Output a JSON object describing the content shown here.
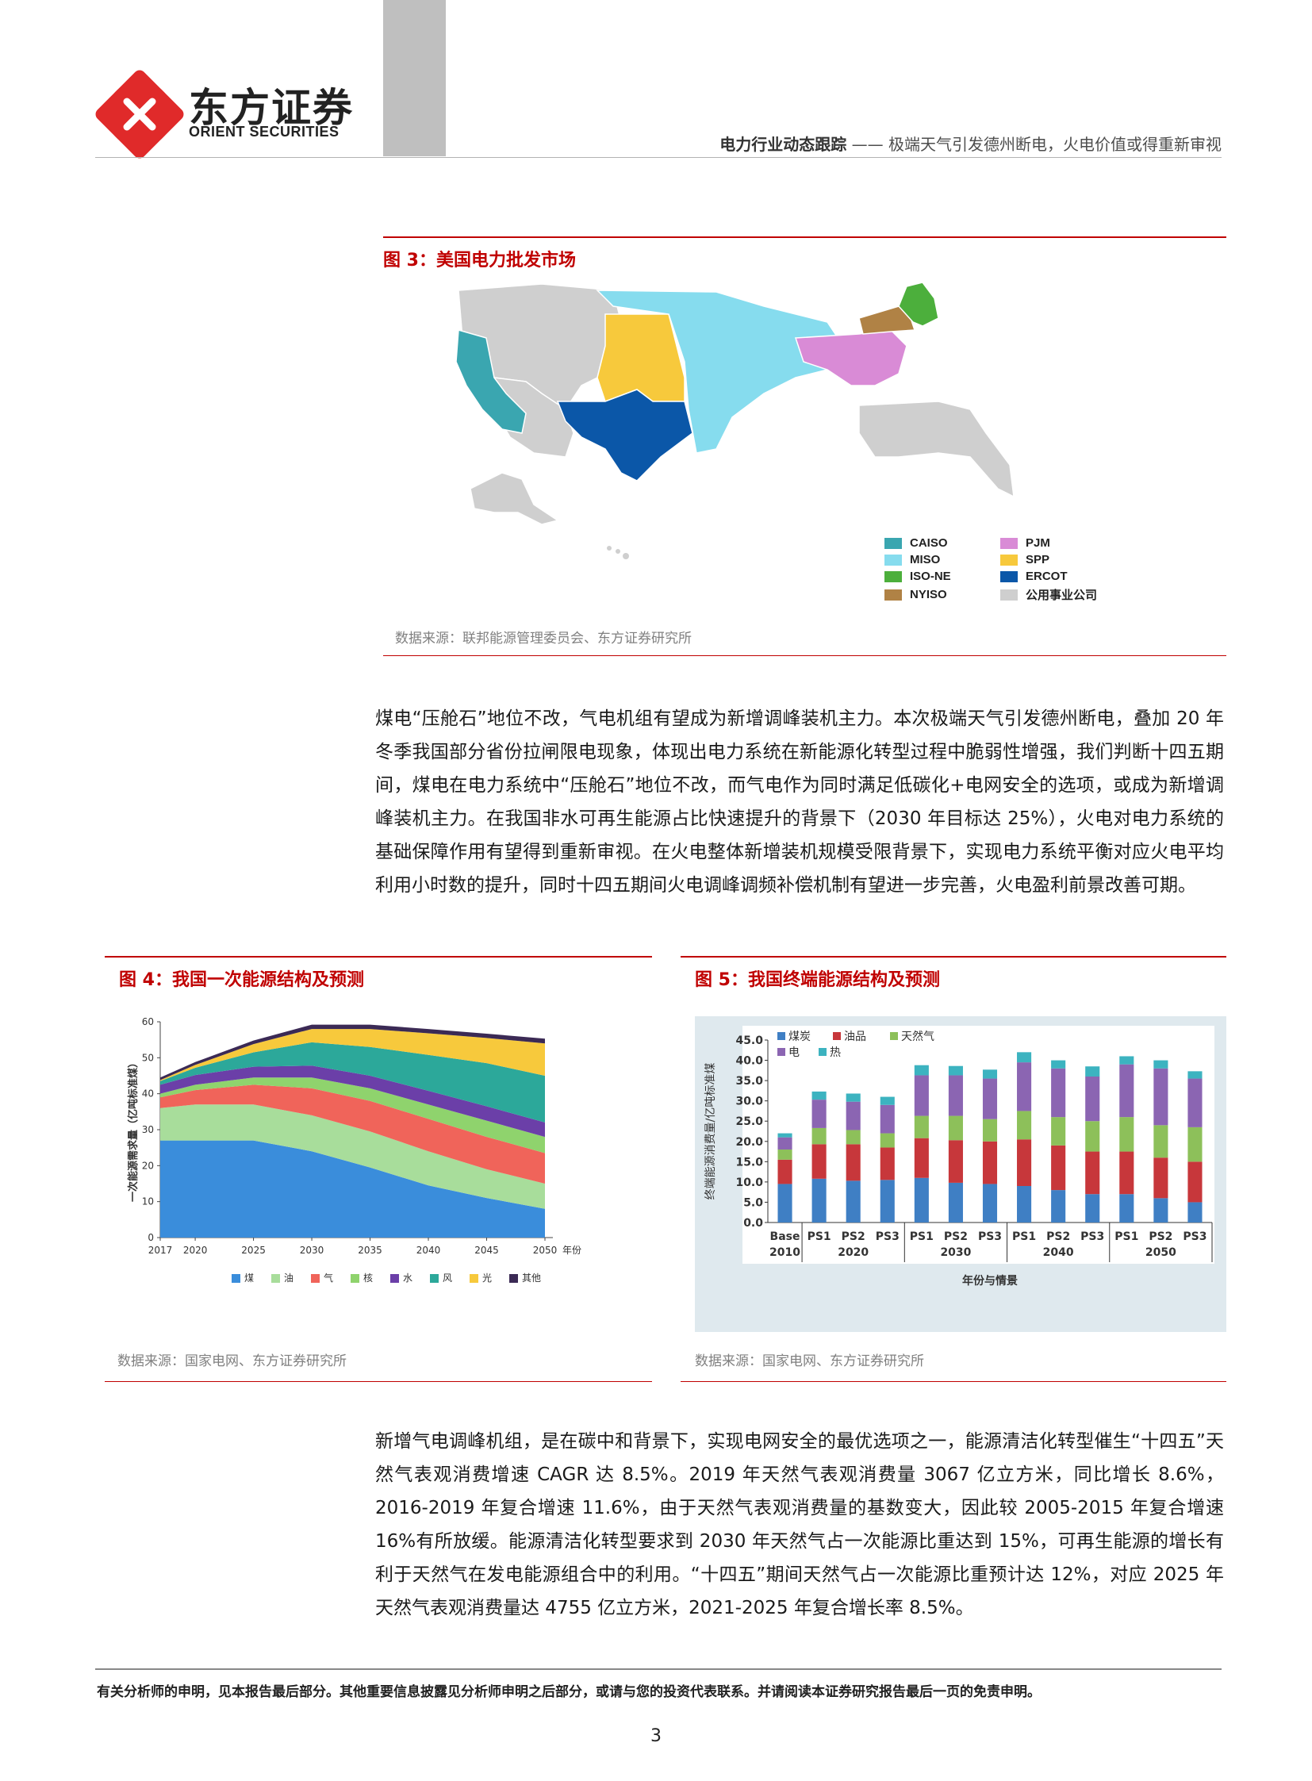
{
  "header": {
    "brand_cn": "东方证券",
    "brand_en": "ORIENT SECURITIES",
    "report_series": "电力行业动态跟踪",
    "report_title": "—— 极端天气引发德州断电，火电价值或得重新审视"
  },
  "figure3": {
    "title": "图 3：美国电力批发市场",
    "source": "数据来源：联邦能源管理委员会、东方证券研究所",
    "legend": [
      {
        "label": "CAISO",
        "color": "#3aa6b0"
      },
      {
        "label": "PJM",
        "color": "#d98bd6"
      },
      {
        "label": "MISO",
        "color": "#86dcee"
      },
      {
        "label": "SPP",
        "color": "#f7c93c"
      },
      {
        "label": "ISO-NE",
        "color": "#4caf3c"
      },
      {
        "label": "ERCOT",
        "color": "#0b57a8"
      },
      {
        "label": "NYISO",
        "color": "#b08245"
      },
      {
        "label": "公用事业公司",
        "color": "#cfcfcf"
      }
    ]
  },
  "paragraph1": "煤电“压舱石”地位不改，气电机组有望成为新增调峰装机主力。本次极端天气引发德州断电，叠加 20 年冬季我国部分省份拉闸限电现象，体现出电力系统在新能源化转型过程中脆弱性增强，我们判断十四五期间，煤电在电力系统中“压舱石”地位不改，而气电作为同时满足低碳化+电网安全的选项，或成为新增调峰装机主力。在我国非水可再生能源占比快速提升的背景下（2030 年目标达 25%），火电对电力系统的基础保障作用有望得到重新审视。在火电整体新增装机规模受限背景下，实现电力系统平衡对应火电平均利用小时数的提升，同时十四五期间火电调峰调频补偿机制有望进一步完善，火电盈利前景改善可期。",
  "figure4": {
    "title": "图 4：我国一次能源结构及预测",
    "source": "数据来源：国家电网、东方证券研究所"
  },
  "figure5": {
    "title": "图 5：我国终端能源结构及预测",
    "source": "数据来源：国家电网、东方证券研究所"
  },
  "paragraph2": "新增气电调峰机组，是在碳中和背景下，实现电网安全的最优选项之一，能源清洁化转型催生“十四五”天然气表观消费增速 CAGR 达 8.5%。2019 年天然气表观消费量 3067 亿立方米，同比增长 8.6%，2016-2019 年复合增速 11.6%，由于天然气表观消费量的基数变大，因此较 2005-2015 年复合增速 16%有所放缓。能源清洁化转型要求到 2030 年天然气占一次能源比重达到 15%，可再生能源的增长有利于天然气在发电能源组合中的利用。“十四五”期间天然气占一次能源比重预计达 12%，对应 2025 年天然气表观消费量达 4755 亿立方米，2021-2025 年复合增长率 8.5%。",
  "footer": {
    "disclaimer": "有关分析师的申明，见本报告最后部分。其他重要信息披露见分析师申明之后部分，或请与您的投资代表联系。并请阅读本证券研究报告最后一页的免责申明。",
    "page_number": "3"
  },
  "chart_data": [
    {
      "type": "area",
      "stacked": true,
      "ylabel": "一次能源需求量（亿吨标准煤）",
      "x_unit": "年份",
      "x": [
        2017,
        2020,
        2025,
        2030,
        2035,
        2040,
        2045,
        2050
      ],
      "x_ticks": [
        "2017",
        "2020",
        "2025",
        "2030",
        "2035",
        "2040",
        "2045",
        "2050"
      ],
      "y_ticks": [
        "0",
        "10",
        "20",
        "30",
        "40",
        "50",
        "60"
      ],
      "ylim": [
        0,
        60
      ],
      "series": [
        {
          "name": "煤",
          "color": "#3a8ddb",
          "values": [
            27,
            27,
            27,
            24,
            19.5,
            14.5,
            11,
            8
          ]
        },
        {
          "name": "油",
          "color": "#a8dd9b",
          "values": [
            9,
            10,
            10,
            10,
            10,
            9.5,
            8,
            7
          ]
        },
        {
          "name": "气",
          "color": "#f0645a",
          "values": [
            3,
            4,
            5.5,
            7.5,
            8.5,
            9,
            9,
            8.5
          ]
        },
        {
          "name": "核",
          "color": "#8fd36d",
          "values": [
            1,
            1.5,
            2,
            3,
            3.5,
            4,
            4.5,
            4.5
          ]
        },
        {
          "name": "水",
          "color": "#6b3fa8",
          "values": [
            2.5,
            2.7,
            3,
            3.3,
            3.5,
            3.8,
            4,
            4
          ]
        },
        {
          "name": "风",
          "color": "#2ca89a",
          "values": [
            1,
            2,
            4,
            6.5,
            8,
            10,
            12,
            13
          ]
        },
        {
          "name": "光",
          "color": "#f7c93c",
          "values": [
            0.3,
            0.8,
            2.3,
            3.7,
            5,
            6,
            7,
            9
          ]
        },
        {
          "name": "其他",
          "color": "#3b2a55",
          "values": [
            0.7,
            0.8,
            1,
            1.2,
            1.2,
            1.2,
            1.2,
            1.3
          ]
        }
      ]
    },
    {
      "type": "bar",
      "stacked": true,
      "ylabel": "终端能源消费量/亿吨标准煤",
      "xlabel": "年份与情景",
      "categories": [
        "Base 2010",
        "PS1",
        "PS2",
        "PS3",
        "PS1",
        "PS2",
        "PS3",
        "PS1",
        "PS2",
        "PS3",
        "PS1",
        "PS2",
        "PS3"
      ],
      "groups": [
        {
          "label": "2020",
          "span": [
            1,
            3
          ]
        },
        {
          "label": "2030",
          "span": [
            4,
            6
          ]
        },
        {
          "label": "2040",
          "span": [
            7,
            9
          ]
        },
        {
          "label": "2050",
          "span": [
            10,
            12
          ]
        }
      ],
      "y_ticks": [
        "0.0",
        "5.0",
        "10.0",
        "15.0",
        "20.0",
        "25.0",
        "30.0",
        "35.0",
        "40.0",
        "45.0"
      ],
      "ylim": [
        0,
        45
      ],
      "series": [
        {
          "name": "煤炭",
          "color": "#3f7fc4",
          "values": [
            9.5,
            10.8,
            10.3,
            10.5,
            11,
            9.8,
            9.5,
            9,
            8,
            7,
            7,
            6,
            5
          ]
        },
        {
          "name": "油品",
          "color": "#c7373b",
          "values": [
            6,
            8.5,
            9,
            8,
            9.8,
            10.5,
            10.5,
            11.5,
            11,
            10.5,
            10.5,
            10,
            10
          ]
        },
        {
          "name": "天然气",
          "color": "#8dc05a",
          "values": [
            2.5,
            4,
            3.5,
            3.5,
            5.5,
            6,
            5.5,
            7,
            7,
            7.5,
            8.5,
            8,
            8.5
          ]
        },
        {
          "name": "电",
          "color": "#8b65b2",
          "values": [
            3,
            7,
            7,
            7,
            10,
            10,
            10,
            12,
            12,
            11,
            13,
            14,
            12
          ]
        },
        {
          "name": "热",
          "color": "#3cb3c0",
          "values": [
            1,
            2,
            2,
            2,
            2.5,
            2.3,
            2.2,
            2.5,
            2,
            2.5,
            2,
            2,
            1.8
          ]
        }
      ]
    }
  ]
}
